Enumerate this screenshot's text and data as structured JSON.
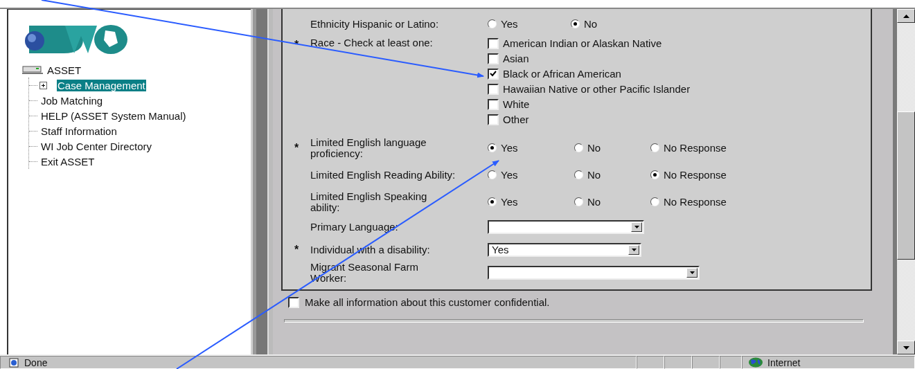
{
  "tree": {
    "label": "ASSET",
    "children": [
      {
        "label": "Case Management",
        "selected": true,
        "expandable": true
      },
      {
        "label": "Job Matching",
        "selected": false,
        "expandable": false
      },
      {
        "label": "HELP (ASSET System Manual)",
        "selected": false,
        "expandable": false
      },
      {
        "label": "Staff Information",
        "selected": false,
        "expandable": false
      },
      {
        "label": "WI Job Center Directory",
        "selected": false,
        "expandable": false
      },
      {
        "label": "Exit ASSET",
        "selected": false,
        "expandable": false
      }
    ]
  },
  "form": {
    "rows": [
      {
        "kind": "radio",
        "label": "Ethnicity Hispanic or Latino:",
        "options": [
          {
            "label": "Yes",
            "selected": false
          },
          {
            "label": "No",
            "selected": true
          }
        ]
      },
      {
        "kind": "checkboxes",
        "marker": "*",
        "label": "Race - Check at least one:",
        "options": [
          {
            "label": "American Indian or Alaskan Native",
            "checked": false
          },
          {
            "label": "Asian",
            "checked": false
          },
          {
            "label": "Black or African American",
            "checked": true
          },
          {
            "label": "Hawaiian Native or other Pacific Islander",
            "checked": false
          },
          {
            "label": "White",
            "checked": false
          },
          {
            "label": "Other",
            "checked": false
          }
        ]
      },
      {
        "kind": "radio",
        "marker": "*",
        "label": "Limited English language proficiency:",
        "options": [
          {
            "label": "Yes",
            "selected": true
          },
          {
            "label": "No",
            "selected": false
          },
          {
            "label": "No Response",
            "selected": false
          }
        ]
      },
      {
        "kind": "radio",
        "label": "Limited English Reading Ability:",
        "options": [
          {
            "label": "Yes",
            "selected": false
          },
          {
            "label": "No",
            "selected": false
          },
          {
            "label": "No Response",
            "selected": true
          }
        ]
      },
      {
        "kind": "radio",
        "label": "Limited English Speaking ability:",
        "options": [
          {
            "label": "Yes",
            "selected": true
          },
          {
            "label": "No",
            "selected": false
          },
          {
            "label": "No Response",
            "selected": false
          }
        ]
      },
      {
        "kind": "select",
        "label": "Primary Language:"
      },
      {
        "kind": "select",
        "marker": "*",
        "label": "Individual with a disability:",
        "value": "Yes"
      },
      {
        "kind": "select",
        "label": "Migrant Seasonal Farm Worker:"
      }
    ]
  },
  "confidential": {
    "label": "Make all information about this customer confidential.",
    "checked": false
  },
  "status_bar": {
    "text": "Done",
    "zone": "Internet"
  }
}
